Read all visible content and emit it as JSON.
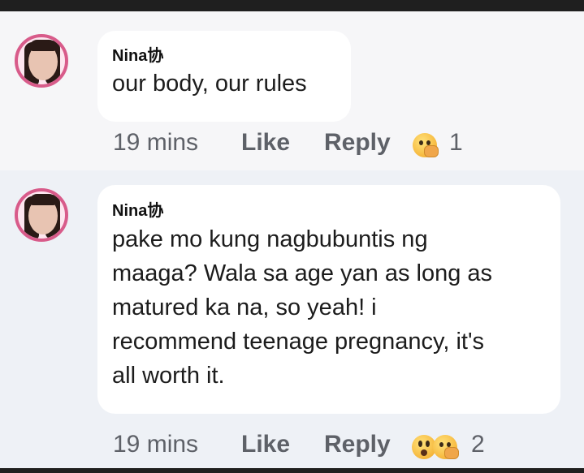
{
  "comments": [
    {
      "author": "Nina协",
      "text": "our body, our rules",
      "time": "19 mins",
      "like_label": "Like",
      "reply_label": "Reply",
      "reaction_icons": [
        "care-emoji-icon"
      ],
      "reaction_count": "1"
    },
    {
      "author": "Nina协",
      "text": "pake mo kung nagbubuntis ng\nmaaga? Wala sa age yan as long as\nmatured ka na, so yeah! i\nrecommend teenage pregnancy, it's\nall worth it.",
      "time": "19 mins",
      "like_label": "Like",
      "reply_label": "Reply",
      "reaction_icons": [
        "wow-emoji-icon",
        "care-emoji-icon"
      ],
      "reaction_count": "2"
    }
  ],
  "colors": {
    "avatar_ring": "#d85b8a",
    "meta_text": "#5e6168",
    "bubble_bg": "#ffffff"
  }
}
